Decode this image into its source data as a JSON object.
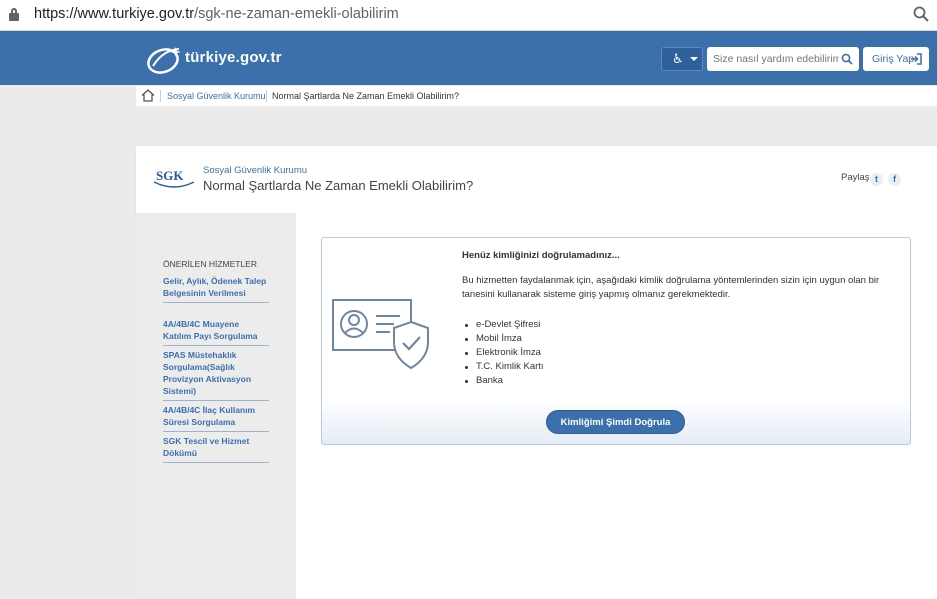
{
  "browser": {
    "url_host": "https://www.turkiye.gov.tr",
    "url_path": "/sgk-ne-zaman-emekli-olabilirim"
  },
  "header": {
    "logo_text": "türkiye.gov.tr",
    "accessibility_icon": "wheelchair-icon",
    "search_placeholder": "Size nasıl yardım edebilirim?",
    "login_label": "Giriş Yap",
    "bg_color": "#3c70ad"
  },
  "breadcrumb": {
    "items": [
      "Sosyal Güvenlik Kurumu",
      "Normal Şartlarda Ne Zaman Emekli Olabilirim?"
    ]
  },
  "page": {
    "institution_logo": "SGK",
    "institution": "Sosyal Güvenlik Kurumu",
    "title": "Normal Şartlarda Ne Zaman Emekli Olabilirim?",
    "share_label": "Paylaş"
  },
  "sidebar": {
    "title": "ÖNERİLEN HİZMETLER",
    "items": [
      "Gelir, Aylık, Ödenek Talep Belgesinin Verilmesi",
      "4A/4B/4C Muayene Katılım Payı Sorgulama",
      "SPAS Müstehaklık Sorgulama(Sağlık Provizyon Aktivasyon Sistemi)",
      "4A/4B/4C İlaç Kullanım Süresi Sorgulama",
      "SGK Tescil ve Hizmet Dökümü"
    ]
  },
  "auth": {
    "title": "Henüz kimliğinizi doğrulamadınız...",
    "body": "Bu hizmetten faydalanmak için, aşağıdaki kimlik doğrulama yöntemlerinden sizin için uygun olan bir tanesini kullanarak sisteme giriş yapmış olmanız gerekmektedir.",
    "methods": [
      "e-Devlet Şifresi",
      "Mobil İmza",
      "Elektronik İmza",
      "T.C. Kimlik Kartı",
      "Banka"
    ],
    "button_label": "Kimliğimi Şimdi Doğrula"
  }
}
